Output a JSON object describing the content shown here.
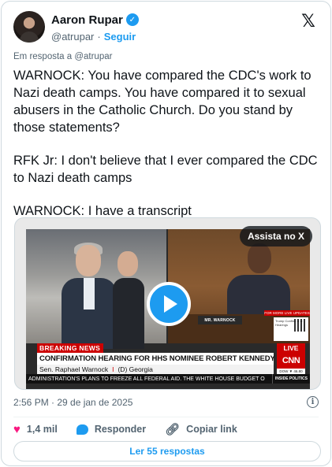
{
  "author": {
    "name": "Aaron Rupar",
    "handle": "@atrupar",
    "separator": "·",
    "follow_label": "Seguir",
    "verified_check": "✓"
  },
  "platform_logo": "𝕏",
  "reply_context": "Em resposta a @atrupar",
  "tweet": {
    "paragraphs": [
      "WARNOCK: You have compared the CDC's work to Nazi death camps. You have compared it to sexual abusers in the Catholic Church. Do you stand by those statements?",
      "RFK Jr: I don't believe that I ever compared the CDC to Nazi death camps",
      "WARNOCK: I have a transcript"
    ]
  },
  "media": {
    "watch_label": "Assista no X",
    "play_icon": "play-icon",
    "broadcast": {
      "breaking": "BREAKING NEWS",
      "live": "LIVE",
      "headline": "CONFIRMATION HEARING FOR HHS NOMINEE ROBERT KENNEDY JR.",
      "subline_name": "Sen. Raphael Warnock",
      "subline_sep": "I",
      "subline_state": "(D) Georgia",
      "network": "CNN",
      "dow": "DOW ▼ 46.80",
      "ticker": "ADMINISTRATION'S PLANS TO FREEZE ALL FEDERAL AID. THE WHITE HOUSE BUDGET O",
      "inside": "INSIDE POLITICS",
      "nameplate": "MR. WARNOCK",
      "more_updates": "FOR MORE LIVE UPDATES",
      "qr_text": "Trump Confirmation Hearings"
    }
  },
  "timestamp": "2:56 PM · 29 de jan de 2025",
  "info_icon": "i",
  "actions": {
    "like_count": "1,4 mil",
    "reply_label": "Responder",
    "copy_label": "Copiar link"
  },
  "read_replies_label": "Ler 55 respostas",
  "colors": {
    "accent": "#1d9bf0",
    "like": "#f91880",
    "cnn_red": "#cc0000",
    "text": "#0f1419",
    "secondary": "#536471"
  }
}
